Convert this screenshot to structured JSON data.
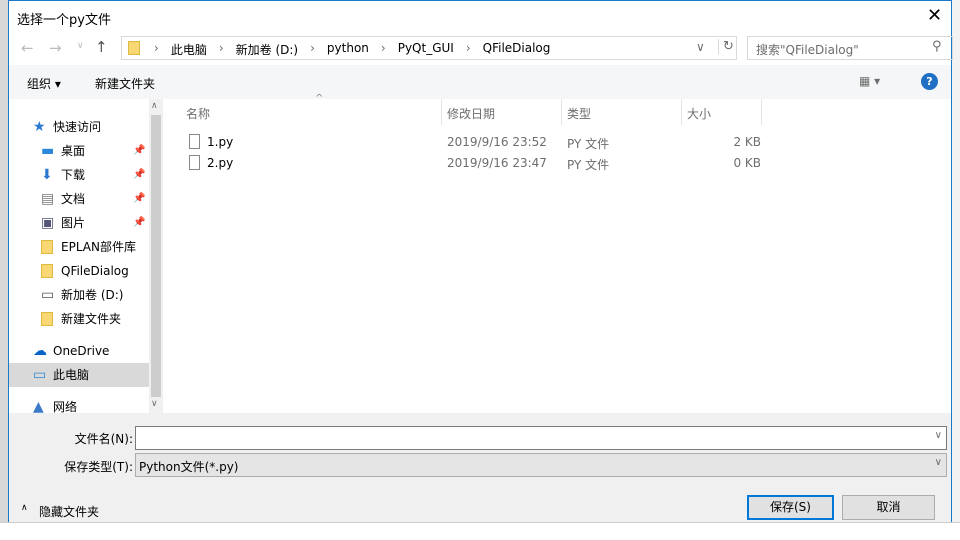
{
  "window": {
    "title": "选择一个py文件",
    "close_icon": "close-icon"
  },
  "nav": {
    "breadcrumb": [
      "此电脑",
      "新加卷 (D:)",
      "python",
      "PyQt_GUI",
      "QFileDialog"
    ],
    "search_placeholder": "搜索\"QFileDialog\""
  },
  "toolbar": {
    "organize": "组织 ▾",
    "new_folder": "新建文件夹",
    "view_icon": "▦ ▾",
    "help": "?"
  },
  "sidebar": {
    "items": [
      {
        "label": "快速访问",
        "icon": "star-icon"
      },
      {
        "label": "桌面",
        "icon": "desktop-icon",
        "pinned": true
      },
      {
        "label": "下载",
        "icon": "download-icon",
        "pinned": true
      },
      {
        "label": "文档",
        "icon": "document-icon",
        "pinned": true
      },
      {
        "label": "图片",
        "icon": "picture-icon",
        "pinned": true
      },
      {
        "label": "EPLAN部件库",
        "icon": "folder-icon"
      },
      {
        "label": "QFileDialog",
        "icon": "folder-icon"
      },
      {
        "label": "新加卷 (D:)",
        "icon": "drive-icon"
      },
      {
        "label": "新建文件夹",
        "icon": "folder-icon"
      },
      {
        "label": "OneDrive",
        "icon": "cloud-icon"
      },
      {
        "label": "此电脑",
        "icon": "computer-icon",
        "selected": true
      },
      {
        "label": "网络",
        "icon": "network-icon"
      }
    ]
  },
  "files": {
    "columns": [
      "名称",
      "修改日期",
      "类型",
      "大小"
    ],
    "rows": [
      {
        "name": "1.py",
        "date": "2019/9/16 23:52",
        "type": "PY 文件",
        "size": "2 KB"
      },
      {
        "name": "2.py",
        "date": "2019/9/16 23:47",
        "type": "PY 文件",
        "size": "0 KB"
      }
    ]
  },
  "bottom": {
    "filename_label": "文件名(N):",
    "filename_value": "",
    "filetype_label": "保存类型(T):",
    "filetype_value": "Python文件(*.py)",
    "hide_folders": "隐藏文件夹",
    "save": "保存(S)",
    "cancel": "取消"
  },
  "colors": {
    "accent": "#0078d7",
    "selected": "#d9d9d9"
  }
}
